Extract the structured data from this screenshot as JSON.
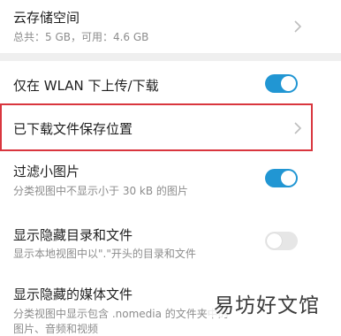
{
  "cloud_storage": {
    "title": "云存储空间",
    "subtitle": "总共：5 GB，可用：4.6 GB"
  },
  "wlan_only": {
    "title": "仅在 WLAN 下上传/下载",
    "enabled": true
  },
  "download_location": {
    "title": "已下载文件保存位置"
  },
  "filter_small": {
    "title": "过滤小图片",
    "subtitle": "分类视图中不显示小于 30 kB 的图片",
    "enabled": true
  },
  "show_hidden": {
    "title": "显示隐藏目录和文件",
    "subtitle": "显示本地视图中以\".\"开头的目录和文件",
    "enabled": false
  },
  "show_hidden_media": {
    "title": "显示隐藏的媒体文件",
    "subtitle_line1": "分类视图中显示包含 .nomedia 的文件夹中的",
    "subtitle_line2": "图片、音频和视频"
  },
  "watermark": "易坊好文馆",
  "colors": {
    "toggle_on": "#2196d3",
    "toggle_off": "#e6e6e6",
    "highlight_border": "#d9363e",
    "section_gap": "#efefef"
  }
}
